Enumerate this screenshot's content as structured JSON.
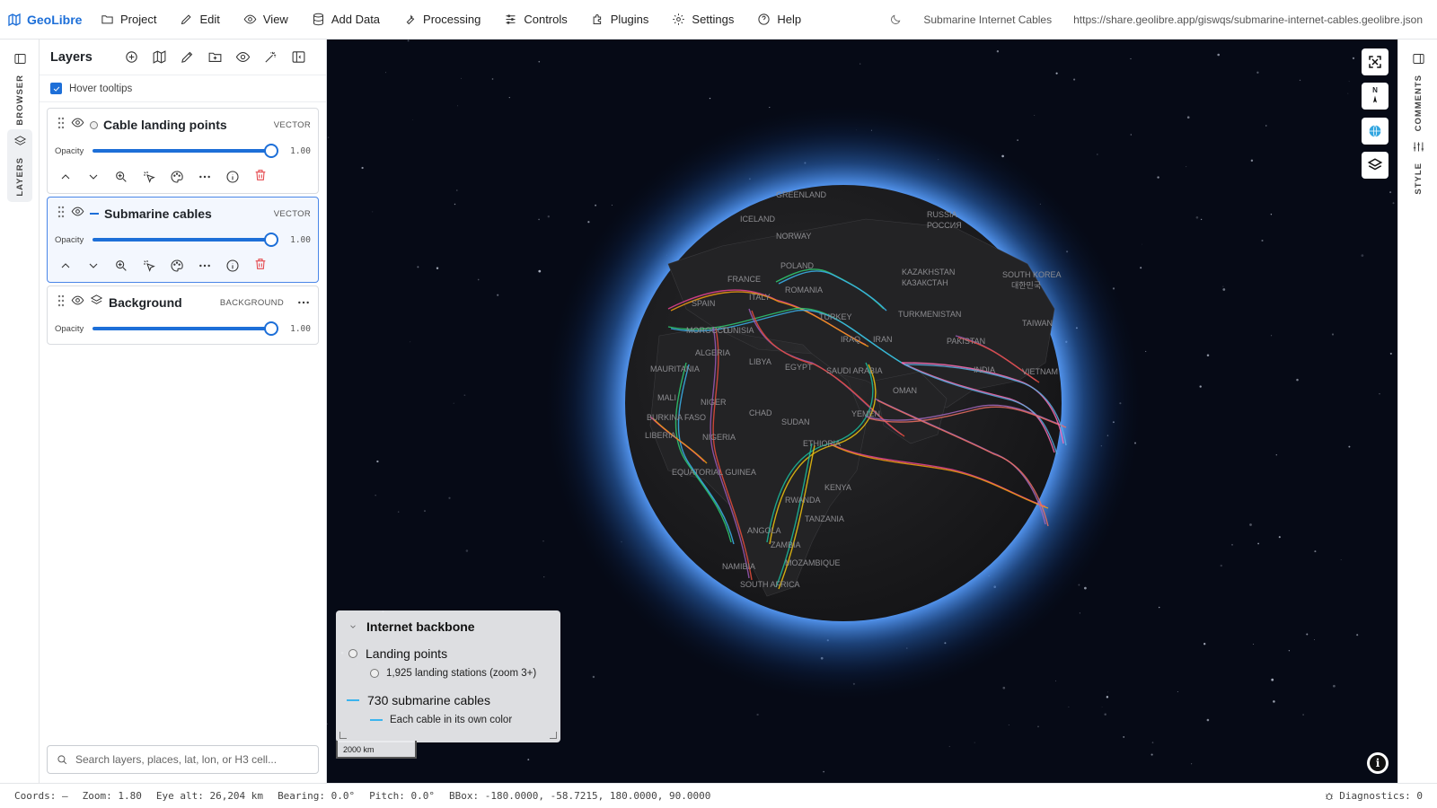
{
  "app": {
    "brand": "GeoLibre",
    "menu": [
      "Project",
      "Edit",
      "View",
      "Add Data",
      "Processing",
      "Controls",
      "Plugins",
      "Settings",
      "Help"
    ],
    "project_title": "Submarine Internet Cables",
    "share_url": "https://share.geolibre.app/giswqs/submarine-internet-cables.geolibre.json"
  },
  "left_rail": {
    "browser": "BROWSER",
    "layers": "LAYERS"
  },
  "right_rail": {
    "comments": "COMMENTS",
    "style": "STYLE"
  },
  "layers_panel": {
    "title": "Layers",
    "hover_tooltips": {
      "label": "Hover tooltips",
      "checked": true
    },
    "opacity_label": "Opacity",
    "layers": [
      {
        "name": "Cable landing points",
        "type": "VECTOR",
        "opacity": "1.00",
        "opacity_fraction": 1.0,
        "visible": true,
        "selected": false
      },
      {
        "name": "Submarine cables",
        "type": "VECTOR",
        "opacity": "1.00",
        "opacity_fraction": 1.0,
        "visible": true,
        "selected": true
      },
      {
        "name": "Background",
        "type": "BACKGROUND",
        "opacity": "1.00",
        "opacity_fraction": 1.0,
        "visible": true,
        "selected": false
      }
    ],
    "search_placeholder": "Search layers, places, lat, lon, or H3 cell..."
  },
  "map": {
    "labels": [
      "GREENLAND",
      "ICELAND",
      "RUSSIA",
      "РОССИЯ",
      "NORWAY",
      "POLAND",
      "FRANCE",
      "SPAIN",
      "ITALY",
      "ROMANIA",
      "KAZAKHSTAN",
      "КАЗАКСТАН",
      "SOUTH KOREA",
      "대한민국",
      "TURKEY",
      "TURKMENISTAN",
      "MOROCCO",
      "TUNISIA",
      "ALGERIA",
      "LIBYA",
      "EGYPT",
      "IRAQ",
      "IRAN",
      "PAKISTAN",
      "TAIWAN",
      "MAURITANIA",
      "SAUDI ARABIA",
      "INDIA",
      "VIETNAM",
      "MALI",
      "NIGER",
      "CHAD",
      "SUDAN",
      "OMAN",
      "BURKINA FASO",
      "YEMEN",
      "LIBERIA",
      "NIGERIA",
      "ETHIOPIA",
      "EQUATORIAL GUINEA",
      "KENYA",
      "RWANDA",
      "TANZANIA",
      "ANGOLA",
      "ZAMBIA",
      "NAMIBIA",
      "MOZAMBIQUE",
      "SOUTH AFRICA"
    ],
    "compass": "N",
    "accent": "#1d6fd8"
  },
  "legend": {
    "title": "Internet backbone",
    "landing_title": "Landing points",
    "landing_desc": "1,925 landing stations (zoom 3+)",
    "cables_title": "730 submarine cables",
    "cables_desc": "Each cable in its own color",
    "cable_color": "#3bb4ee"
  },
  "scale": {
    "label": "2000 km"
  },
  "status": {
    "coords": "Coords: —",
    "zoom": "Zoom: 1.80",
    "eye_alt": "Eye alt: 26,204 km",
    "bearing": "Bearing: 0.0°",
    "pitch": "Pitch: 0.0°",
    "bbox": "BBox: -180.0000, -58.7215, 180.0000, 90.0000",
    "diagnostics": "Diagnostics: 0"
  }
}
